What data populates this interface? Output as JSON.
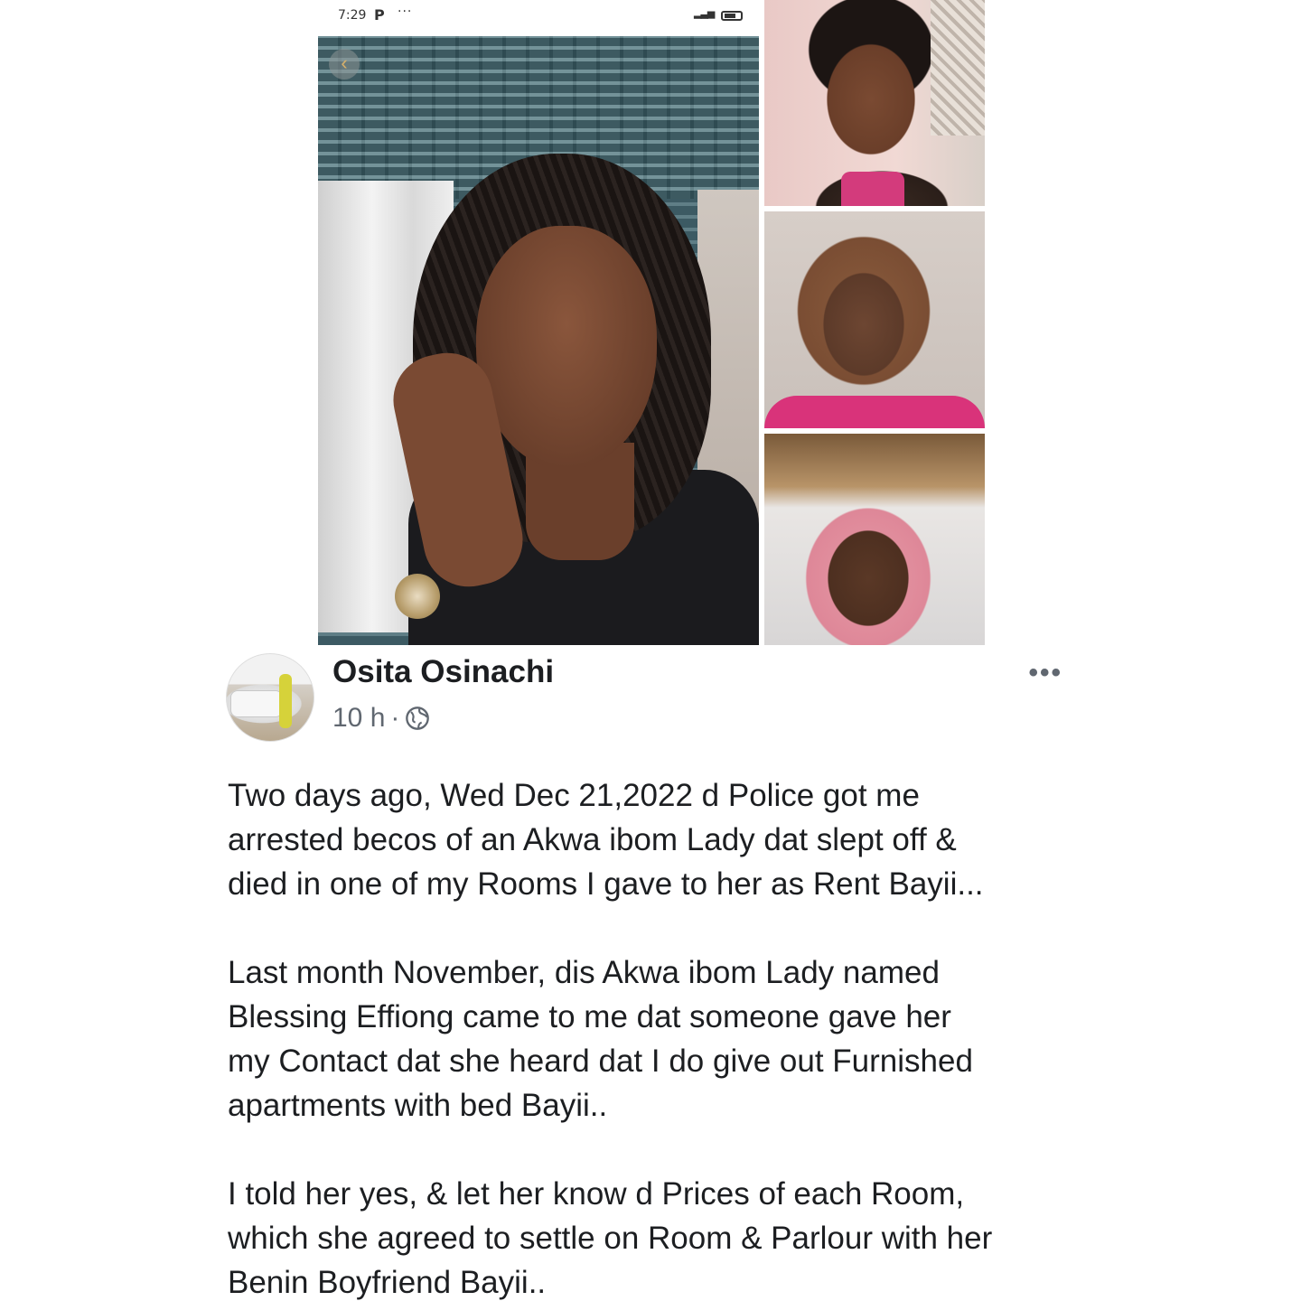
{
  "status_bar": {
    "time": "7:29",
    "app_indicator": "P",
    "more": "···"
  },
  "collage": {
    "back_icon": "chevron-left-icon"
  },
  "post": {
    "author_name": "Osita Osinachi",
    "timestamp": "10 h",
    "separator": "·",
    "privacy_icon": "globe-icon",
    "more_icon": "•••",
    "paragraphs": [
      "Two days ago, Wed Dec 21,2022 d Police got me\narrested becos of an Akwa ibom Lady dat slept off &\ndied in one of my Rooms I gave to her as Rent Bayii...",
      "Last month November, dis Akwa ibom Lady named\nBlessing Effiong came to me dat someone gave her\nmy Contact dat she heard dat I do give out Furnished\napartments with bed Bayii..",
      "I told her yes, & let her know d Prices of each Room,\nwhich she agreed to settle on Room & Parlour with her\nBenin Boyfriend Bayii.."
    ]
  },
  "colors": {
    "text": "#1c1e21",
    "meta": "#606770",
    "accent_pink": "#d9337a"
  }
}
